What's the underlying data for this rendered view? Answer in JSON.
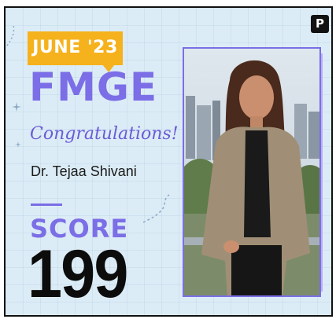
{
  "badge": {
    "text": "JUNE '23"
  },
  "exam": "FMGE",
  "congrats": "Congratulations!",
  "doctor_name": "Dr. Tejaa Shivani",
  "score": {
    "label": "SCORE",
    "value": "199"
  },
  "logo": {
    "letter": "P"
  },
  "colors": {
    "background": "#dcecf6",
    "accent": "#7b6ee6",
    "badge": "#f5b21c",
    "text": "#0c0c0c"
  },
  "photo": {
    "description": "portrait"
  }
}
